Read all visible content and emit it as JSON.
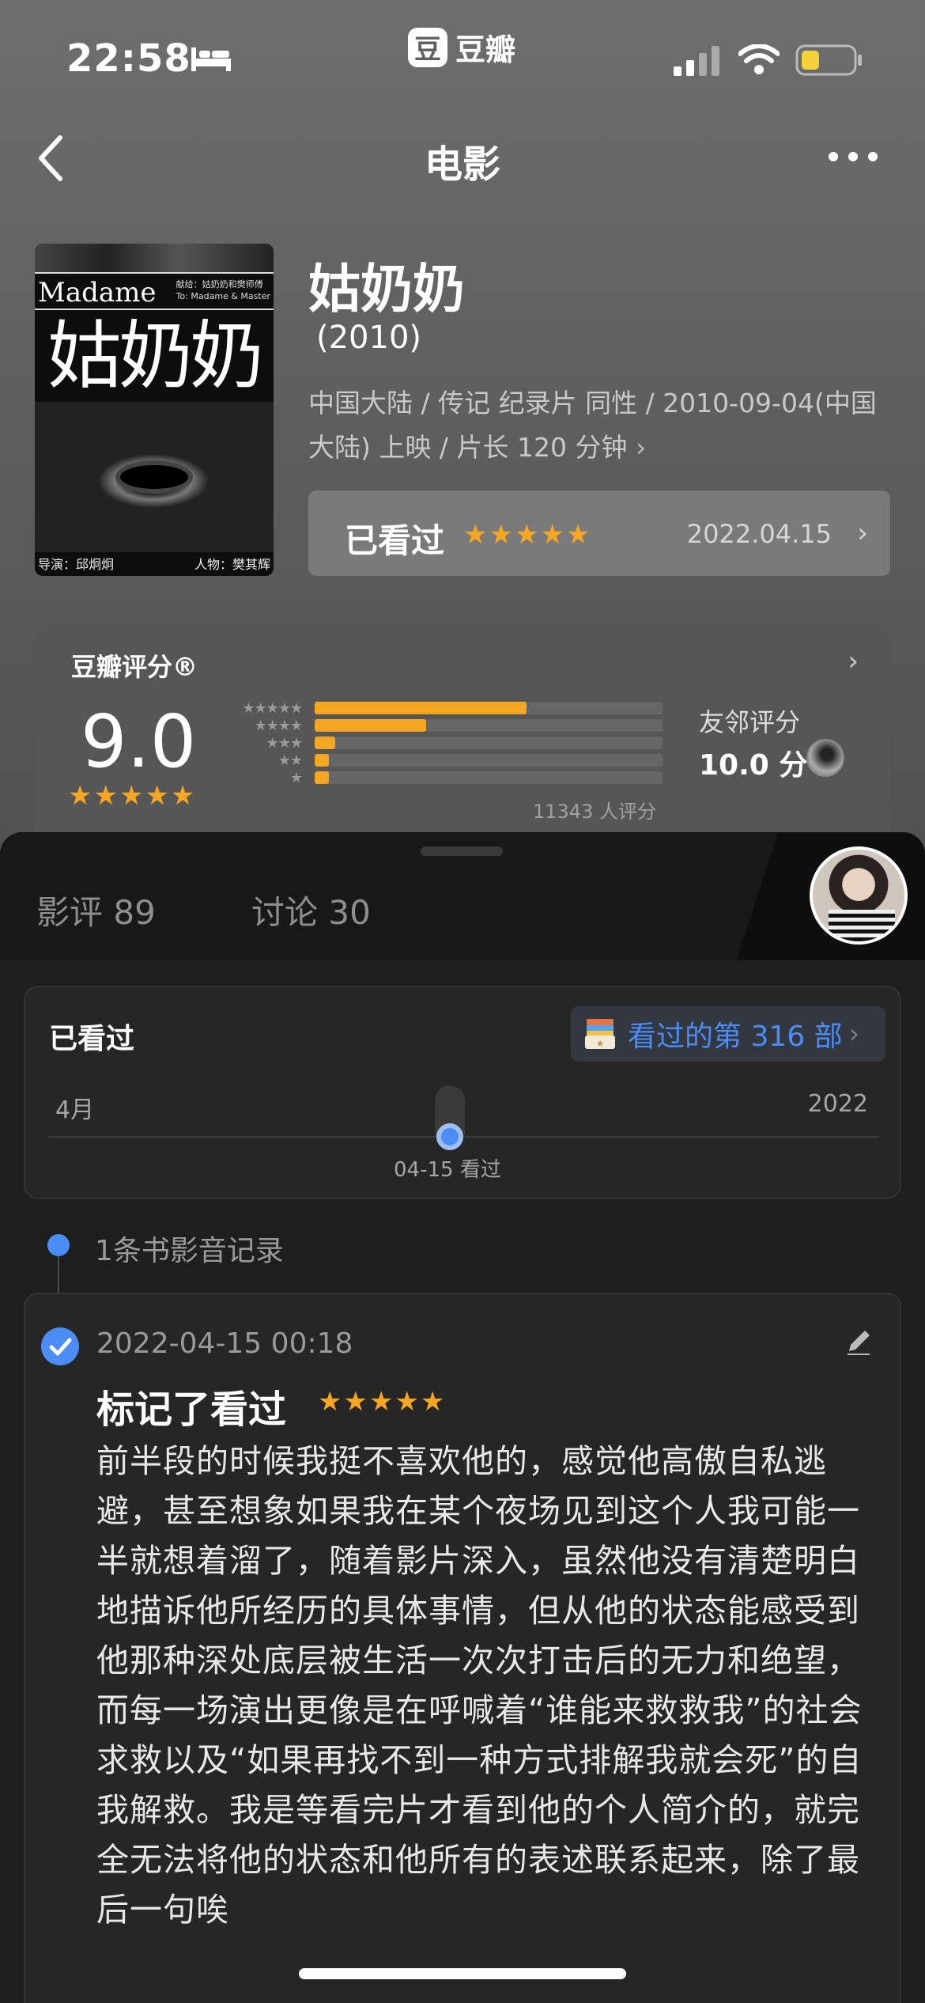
{
  "status_bar": {
    "time": "22:58",
    "app_name": "豆瓣",
    "app_logo_char": "豆",
    "battery_color": "#f5d13a"
  },
  "nav": {
    "title": "电影"
  },
  "poster": {
    "madame": "Madame",
    "dedication_1": "献给：姑奶奶和樊师傅",
    "dedication_2": "To: Madame & Master",
    "big_title": "姑奶奶",
    "director": "导演：邱炯炯",
    "character": "人物：樊其辉"
  },
  "movie": {
    "title": "姑奶奶",
    "year": "(2010)",
    "meta_line1": "中国大陆 / 传记 纪录片 同性 / 2010-09-04(中国",
    "meta_line2": "大陆) 上映 / 片长 120 分钟",
    "meta_chevron": "›"
  },
  "my_status": {
    "label": "已看过",
    "stars": "★★★★★",
    "date": "2022.04.15",
    "chevron": "›"
  },
  "rating": {
    "title": "豆瓣评分®",
    "chevron": "›",
    "score": "9.0",
    "stars": "★★★★★",
    "count_text": "11343 人评分",
    "distribution": [
      {
        "label": "★★★★★",
        "fraction": 0.61
      },
      {
        "label": "★★★★",
        "fraction": 0.32
      },
      {
        "label": "★★★",
        "fraction": 0.06
      },
      {
        "label": "★★",
        "fraction": 0.04
      },
      {
        "label": "★",
        "fraction": 0.04
      }
    ],
    "friend_label": "友邻评分",
    "friend_score": "10.0 分"
  },
  "tabs": [
    {
      "label": "影评 89"
    },
    {
      "label": "讨论 30"
    }
  ],
  "watched_card": {
    "title": "已看过",
    "count_text": "看过的第 316 部",
    "chevron": "›",
    "timeline_month": "4月",
    "timeline_year": "2022",
    "timeline_caption": "04-15 看过"
  },
  "records": {
    "count_text": "1条书影音记录",
    "time": "2022-04-15 00:18",
    "title": "标记了看过",
    "stars": "★★★★★",
    "text": "前半段的时候我挺不喜欢他的，感觉他高傲自私逃避，甚至想象如果我在某个夜场见到这个人我可能一半就想着溜了，随着影片深入，虽然他没有清楚明白地描诉他所经历的具体事情，但从他的状态能感受到他那种深处底层被生活一次次打击后的无力和绝望，而每一场演出更像是在呼喊着“谁能来救救我”的社会求救以及“如果再找不到一种方式排解我就会死”的自我解救。我是等看完片才看到他的个人简介的，就完全无法将他的状态和他所有的表述联系起来，除了最后一句唉"
  },
  "colors": {
    "accent_blue": "#4b8cf5",
    "star_orange": "#f5a623"
  }
}
